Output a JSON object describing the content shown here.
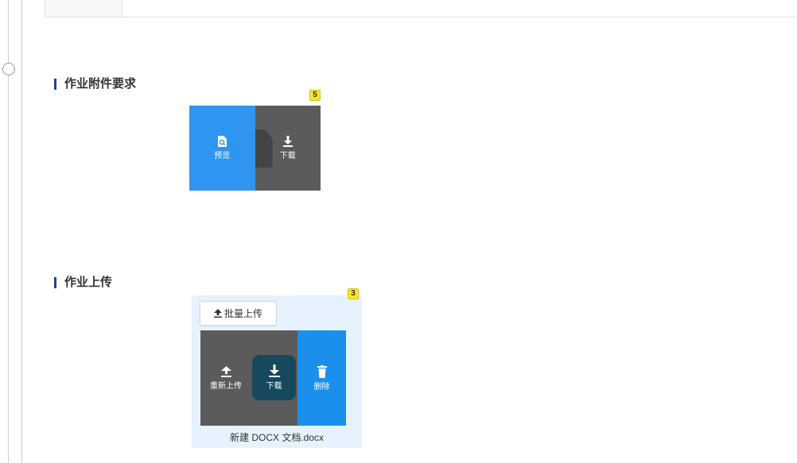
{
  "sections": {
    "requirements": {
      "title": "作业附件要求",
      "badge": "5",
      "attachment": {
        "preview_label": "预览",
        "download_label": "下载"
      }
    },
    "upload": {
      "title": "作业上传",
      "badge": "3",
      "batch_upload_label": "批量上传",
      "file": {
        "reupload_label": "重新上传",
        "download_label": "下载",
        "delete_label": "删除",
        "name": "新建 DOCX 文档.docx"
      }
    }
  },
  "colors": {
    "accent_blue": "#2e95f0",
    "dark_gray": "#5b5b5b",
    "badge_yellow": "#f7e52a",
    "title_bar": "#2b3f8f",
    "upload_bg": "#e6f2fd"
  },
  "icons": {
    "preview": "file-search-icon",
    "download": "download-icon",
    "upload": "upload-icon",
    "delete": "trash-icon"
  }
}
